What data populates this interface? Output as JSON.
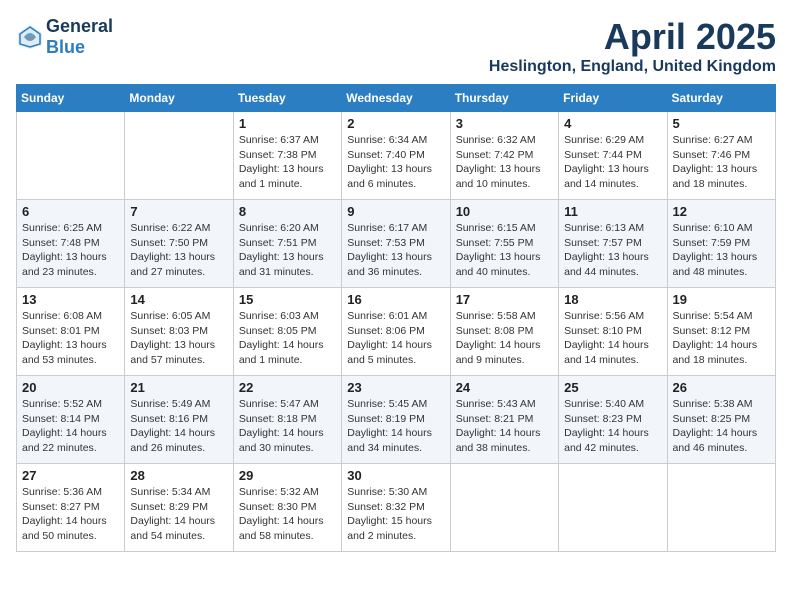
{
  "header": {
    "logo_general": "General",
    "logo_blue": "Blue",
    "month_title": "April 2025",
    "location": "Heslington, England, United Kingdom"
  },
  "days_of_week": [
    "Sunday",
    "Monday",
    "Tuesday",
    "Wednesday",
    "Thursday",
    "Friday",
    "Saturday"
  ],
  "weeks": [
    [
      {
        "day": "",
        "sunrise": "",
        "sunset": "",
        "daylight": ""
      },
      {
        "day": "",
        "sunrise": "",
        "sunset": "",
        "daylight": ""
      },
      {
        "day": "1",
        "sunrise": "Sunrise: 6:37 AM",
        "sunset": "Sunset: 7:38 PM",
        "daylight": "Daylight: 13 hours and 1 minute."
      },
      {
        "day": "2",
        "sunrise": "Sunrise: 6:34 AM",
        "sunset": "Sunset: 7:40 PM",
        "daylight": "Daylight: 13 hours and 6 minutes."
      },
      {
        "day": "3",
        "sunrise": "Sunrise: 6:32 AM",
        "sunset": "Sunset: 7:42 PM",
        "daylight": "Daylight: 13 hours and 10 minutes."
      },
      {
        "day": "4",
        "sunrise": "Sunrise: 6:29 AM",
        "sunset": "Sunset: 7:44 PM",
        "daylight": "Daylight: 13 hours and 14 minutes."
      },
      {
        "day": "5",
        "sunrise": "Sunrise: 6:27 AM",
        "sunset": "Sunset: 7:46 PM",
        "daylight": "Daylight: 13 hours and 18 minutes."
      }
    ],
    [
      {
        "day": "6",
        "sunrise": "Sunrise: 6:25 AM",
        "sunset": "Sunset: 7:48 PM",
        "daylight": "Daylight: 13 hours and 23 minutes."
      },
      {
        "day": "7",
        "sunrise": "Sunrise: 6:22 AM",
        "sunset": "Sunset: 7:50 PM",
        "daylight": "Daylight: 13 hours and 27 minutes."
      },
      {
        "day": "8",
        "sunrise": "Sunrise: 6:20 AM",
        "sunset": "Sunset: 7:51 PM",
        "daylight": "Daylight: 13 hours and 31 minutes."
      },
      {
        "day": "9",
        "sunrise": "Sunrise: 6:17 AM",
        "sunset": "Sunset: 7:53 PM",
        "daylight": "Daylight: 13 hours and 36 minutes."
      },
      {
        "day": "10",
        "sunrise": "Sunrise: 6:15 AM",
        "sunset": "Sunset: 7:55 PM",
        "daylight": "Daylight: 13 hours and 40 minutes."
      },
      {
        "day": "11",
        "sunrise": "Sunrise: 6:13 AM",
        "sunset": "Sunset: 7:57 PM",
        "daylight": "Daylight: 13 hours and 44 minutes."
      },
      {
        "day": "12",
        "sunrise": "Sunrise: 6:10 AM",
        "sunset": "Sunset: 7:59 PM",
        "daylight": "Daylight: 13 hours and 48 minutes."
      }
    ],
    [
      {
        "day": "13",
        "sunrise": "Sunrise: 6:08 AM",
        "sunset": "Sunset: 8:01 PM",
        "daylight": "Daylight: 13 hours and 53 minutes."
      },
      {
        "day": "14",
        "sunrise": "Sunrise: 6:05 AM",
        "sunset": "Sunset: 8:03 PM",
        "daylight": "Daylight: 13 hours and 57 minutes."
      },
      {
        "day": "15",
        "sunrise": "Sunrise: 6:03 AM",
        "sunset": "Sunset: 8:05 PM",
        "daylight": "Daylight: 14 hours and 1 minute."
      },
      {
        "day": "16",
        "sunrise": "Sunrise: 6:01 AM",
        "sunset": "Sunset: 8:06 PM",
        "daylight": "Daylight: 14 hours and 5 minutes."
      },
      {
        "day": "17",
        "sunrise": "Sunrise: 5:58 AM",
        "sunset": "Sunset: 8:08 PM",
        "daylight": "Daylight: 14 hours and 9 minutes."
      },
      {
        "day": "18",
        "sunrise": "Sunrise: 5:56 AM",
        "sunset": "Sunset: 8:10 PM",
        "daylight": "Daylight: 14 hours and 14 minutes."
      },
      {
        "day": "19",
        "sunrise": "Sunrise: 5:54 AM",
        "sunset": "Sunset: 8:12 PM",
        "daylight": "Daylight: 14 hours and 18 minutes."
      }
    ],
    [
      {
        "day": "20",
        "sunrise": "Sunrise: 5:52 AM",
        "sunset": "Sunset: 8:14 PM",
        "daylight": "Daylight: 14 hours and 22 minutes."
      },
      {
        "day": "21",
        "sunrise": "Sunrise: 5:49 AM",
        "sunset": "Sunset: 8:16 PM",
        "daylight": "Daylight: 14 hours and 26 minutes."
      },
      {
        "day": "22",
        "sunrise": "Sunrise: 5:47 AM",
        "sunset": "Sunset: 8:18 PM",
        "daylight": "Daylight: 14 hours and 30 minutes."
      },
      {
        "day": "23",
        "sunrise": "Sunrise: 5:45 AM",
        "sunset": "Sunset: 8:19 PM",
        "daylight": "Daylight: 14 hours and 34 minutes."
      },
      {
        "day": "24",
        "sunrise": "Sunrise: 5:43 AM",
        "sunset": "Sunset: 8:21 PM",
        "daylight": "Daylight: 14 hours and 38 minutes."
      },
      {
        "day": "25",
        "sunrise": "Sunrise: 5:40 AM",
        "sunset": "Sunset: 8:23 PM",
        "daylight": "Daylight: 14 hours and 42 minutes."
      },
      {
        "day": "26",
        "sunrise": "Sunrise: 5:38 AM",
        "sunset": "Sunset: 8:25 PM",
        "daylight": "Daylight: 14 hours and 46 minutes."
      }
    ],
    [
      {
        "day": "27",
        "sunrise": "Sunrise: 5:36 AM",
        "sunset": "Sunset: 8:27 PM",
        "daylight": "Daylight: 14 hours and 50 minutes."
      },
      {
        "day": "28",
        "sunrise": "Sunrise: 5:34 AM",
        "sunset": "Sunset: 8:29 PM",
        "daylight": "Daylight: 14 hours and 54 minutes."
      },
      {
        "day": "29",
        "sunrise": "Sunrise: 5:32 AM",
        "sunset": "Sunset: 8:30 PM",
        "daylight": "Daylight: 14 hours and 58 minutes."
      },
      {
        "day": "30",
        "sunrise": "Sunrise: 5:30 AM",
        "sunset": "Sunset: 8:32 PM",
        "daylight": "Daylight: 15 hours and 2 minutes."
      },
      {
        "day": "",
        "sunrise": "",
        "sunset": "",
        "daylight": ""
      },
      {
        "day": "",
        "sunrise": "",
        "sunset": "",
        "daylight": ""
      },
      {
        "day": "",
        "sunrise": "",
        "sunset": "",
        "daylight": ""
      }
    ]
  ]
}
